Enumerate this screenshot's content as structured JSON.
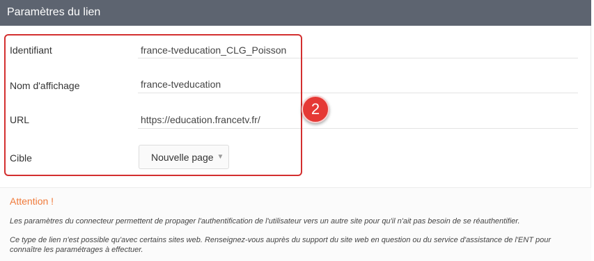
{
  "header": {
    "title": "Paramètres du lien"
  },
  "form": {
    "identifiant": {
      "label": "Identifiant",
      "value": "france-tveducation_CLG_Poisson"
    },
    "nom_affichage": {
      "label": "Nom d'affichage",
      "value": "france-tveducation"
    },
    "url": {
      "label": "URL",
      "value": "https://education.francetv.fr/"
    },
    "cible": {
      "label": "Cible",
      "selected": "Nouvelle page",
      "caret": "▼"
    }
  },
  "annotation": {
    "step": "2",
    "color": "#e53935"
  },
  "warning": {
    "title": "Attention !",
    "line1": "Les paramètres du connecteur permettent de propager l'authentification de l'utilisateur vers un autre site pour qu'il n'ait pas besoin de se réauthentifier.",
    "line2": "Ce type de lien n'est possible qu'avec certains sites web. Renseignez-vous auprès du support du site web en question ou du service d'assistance de l'ENT pour connaître les paramétrages à effectuer."
  }
}
